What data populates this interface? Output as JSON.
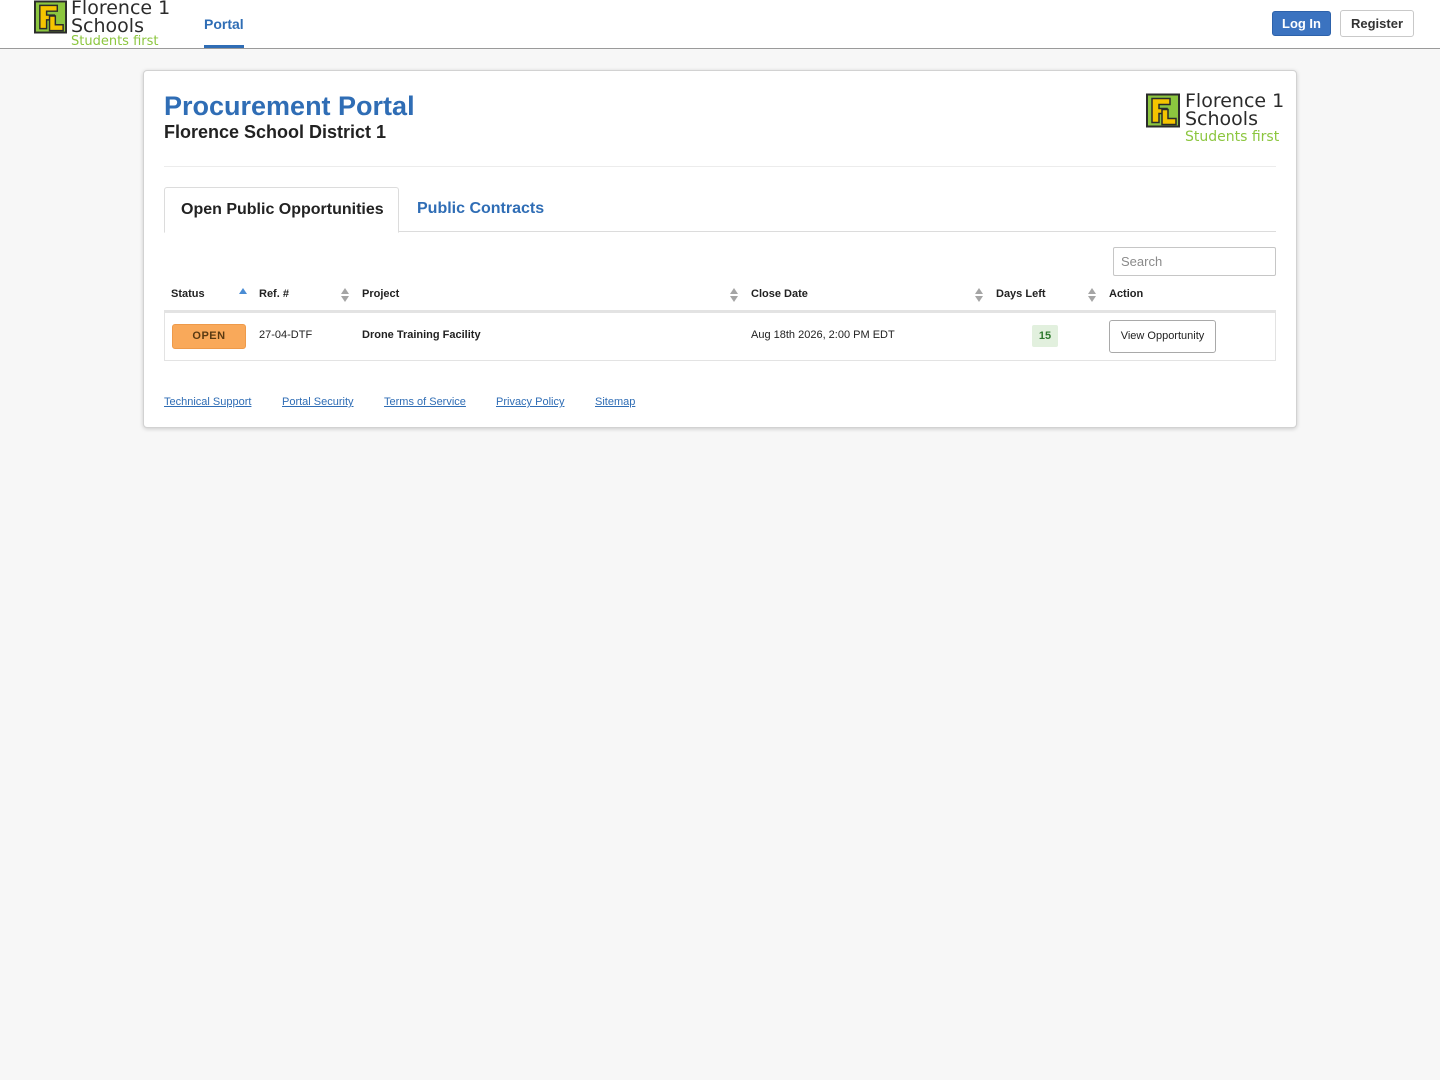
{
  "brand": {
    "name_line1": "Florence 1",
    "name_line2": "Schools",
    "tagline": "Students first",
    "colors": {
      "mark_green": "#8cc63f",
      "mark_yellow": "#f5c400",
      "mark_dark": "#2b2b2b",
      "tagline": "#8cc63f"
    }
  },
  "navbar": {
    "nav_item": "Portal",
    "login_label": "Log In",
    "register_label": "Register",
    "accent_color": "#2f6db5"
  },
  "header": {
    "title": "Procurement Portal",
    "subtitle": "Florence School District 1"
  },
  "tabs": [
    {
      "label": "Open Public Opportunities",
      "active": true
    },
    {
      "label": "Public Contracts",
      "active": false
    }
  ],
  "search": {
    "placeholder": "Search",
    "value": ""
  },
  "table": {
    "columns": [
      {
        "label": "Status",
        "sort": "ascending"
      },
      {
        "label": "Ref. #",
        "sort": "none"
      },
      {
        "label": "Project",
        "sort": "none"
      },
      {
        "label": "Close Date",
        "sort": "none"
      },
      {
        "label": "Days Left",
        "sort": "none"
      },
      {
        "label": "Action",
        "sort": "none"
      }
    ],
    "rows": [
      {
        "status": "OPEN",
        "ref": "27-04-DTF",
        "project": "Drone Training Facility",
        "close_date": "Aug 18th 2026, 2:00 PM EDT",
        "days_left": "15",
        "action": "View Opportunity"
      }
    ]
  },
  "footer": {
    "links": [
      "Technical Support",
      "Portal Security",
      "Terms of Service",
      "Privacy Policy",
      "Sitemap"
    ]
  }
}
